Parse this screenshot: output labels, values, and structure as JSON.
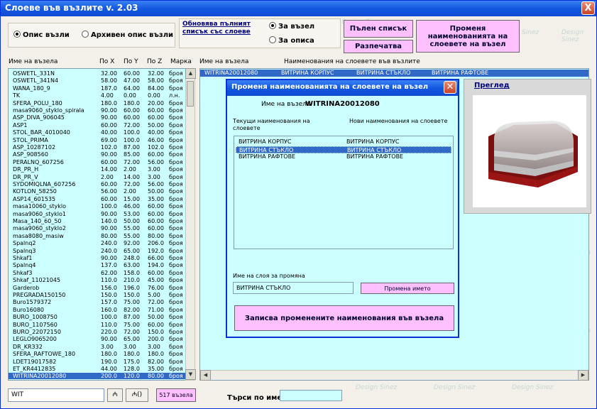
{
  "window": {
    "title": "Слоеве във възлите v. 2.03",
    "close": "X"
  },
  "radio_group1": [
    {
      "label": "Опис възли",
      "checked": true
    },
    {
      "label": "Архивен опис възли",
      "checked": false
    }
  ],
  "refresh_label": "Обновява пълният списък със слоеве",
  "radio_group2": [
    {
      "label": "За възел",
      "checked": true
    },
    {
      "label": "За описа",
      "checked": false
    }
  ],
  "buttons": {
    "full_list": "Пълен списък",
    "print": "Разпечатва",
    "rename_nodes": "Променя наименованията на слоевете на възел"
  },
  "list_headers": {
    "name": "Име на възела",
    "x": "По X",
    "y": "По Y",
    "z": "По Z",
    "brand": "Марка"
  },
  "right_headers": {
    "name": "Име на възела",
    "layers": "Наименования на слоевете във възлите"
  },
  "right_row": {
    "name": "WITRINA20012080",
    "c1": "ВИТРИНА КОРПУС",
    "c2": "ВИТРИНА СТЪКЛО",
    "c3": "ВИТРИНА РАФТОВЕ"
  },
  "rows": [
    [
      "OSWETL_331N",
      "32.00",
      "60.00",
      "32.00",
      "броя"
    ],
    [
      "OSWETL_341N4",
      "58.00",
      "47.00",
      "58.00",
      "броя"
    ],
    [
      "WANA_180_9",
      "187.0",
      "64.00",
      "84.00",
      "броя"
    ],
    [
      "TK",
      "4.00",
      "0.00",
      "0.00",
      "л.н."
    ],
    [
      "SFERA_POLU_180",
      "180.0",
      "180.0",
      "20.00",
      "броя"
    ],
    [
      "masa9060_styklo_spirala",
      "90.00",
      "60.00",
      "60.00",
      "броя"
    ],
    [
      "ASP_DIVA_906045",
      "90.00",
      "60.00",
      "60.00",
      "броя"
    ],
    [
      "ASP1",
      "60.00",
      "72.00",
      "50.00",
      "броя"
    ],
    [
      "STOL_BAR_4010040",
      "40.00",
      "100.0",
      "40.00",
      "броя"
    ],
    [
      "STOL_PRIMA",
      "69.00",
      "100.0",
      "46.00",
      "броя"
    ],
    [
      "ASP_10287102",
      "102.0",
      "87.00",
      "102.0",
      "броя"
    ],
    [
      "ASP_908560",
      "90.00",
      "85.00",
      "60.00",
      "броя"
    ],
    [
      "PERALNQ_607256",
      "60.00",
      "72.00",
      "56.00",
      "броя"
    ],
    [
      "DR_PR_H",
      "14.00",
      "2.00",
      "3.00",
      "броя"
    ],
    [
      "DR_PR_V",
      "2.00",
      "14.00",
      "3.00",
      "броя"
    ],
    [
      "SYDOMIQLNA_607256",
      "60.00",
      "72.00",
      "56.00",
      "броя"
    ],
    [
      "KOTLON_58250",
      "56.00",
      "2.00",
      "50.00",
      "броя"
    ],
    [
      "ASP14_601535",
      "60.00",
      "15.00",
      "35.00",
      "броя"
    ],
    [
      "masa10060_styklo",
      "100.0",
      "46.00",
      "60.00",
      "броя"
    ],
    [
      "masa9060_styklo1",
      "90.00",
      "53.00",
      "60.00",
      "броя"
    ],
    [
      "Masa_140_60_50",
      "140.0",
      "50.00",
      "60.00",
      "броя"
    ],
    [
      "masa9060_styklo2",
      "90.00",
      "55.00",
      "60.00",
      "броя"
    ],
    [
      "masa8080_masiw",
      "80.00",
      "55.00",
      "80.00",
      "броя"
    ],
    [
      "Spalnq2",
      "240.0",
      "92.00",
      "206.0",
      "броя"
    ],
    [
      "Spalnq3",
      "240.0",
      "65.00",
      "192.0",
      "броя"
    ],
    [
      "Shkaf1",
      "90.00",
      "248.0",
      "66.00",
      "броя"
    ],
    [
      "Spalnq4",
      "137.0",
      "63.00",
      "194.0",
      "броя"
    ],
    [
      "Shkaf3",
      "62.00",
      "158.0",
      "60.00",
      "броя"
    ],
    [
      "Shkaf_11021045",
      "110.0",
      "210.0",
      "45.00",
      "броя"
    ],
    [
      "Garderob",
      "156.0",
      "196.0",
      "76.00",
      "броя"
    ],
    [
      "PREGRADA150150",
      "150.0",
      "150.0",
      "5.00",
      "броя"
    ],
    [
      "Buro1579372",
      "157.0",
      "75.00",
      "72.00",
      "броя"
    ],
    [
      "Buro16080",
      "160.0",
      "82.00",
      "71.00",
      "броя"
    ],
    [
      "BURO_1008750",
      "100.0",
      "87.00",
      "50.00",
      "броя"
    ],
    [
      "BURO_1107560",
      "110.0",
      "75.00",
      "60.00",
      "броя"
    ],
    [
      "BURO_22072150",
      "220.0",
      "72.00",
      "150.0",
      "броя"
    ],
    [
      "LEGLO9065200",
      "90.00",
      "65.00",
      "200.0",
      "броя"
    ],
    [
      "DR_KR332",
      "3.00",
      "3.00",
      "3.00",
      "броя"
    ],
    [
      "SFERA_RAFTOWE_180",
      "180.0",
      "180.0",
      "180.0",
      "броя"
    ],
    [
      "LDET19017582",
      "190.0",
      "175.0",
      "82.00",
      "броя"
    ],
    [
      "ET_KR4412835",
      "44.00",
      "128.0",
      "35.00",
      "броя"
    ],
    [
      "WITRINA20012080",
      "200.0",
      "120.0",
      "80.00",
      "броя"
    ]
  ],
  "selected_row": 41,
  "search": {
    "value": "WIT",
    "find_glyph": "₼",
    "find_next_glyph": "₼()",
    "count": "517 възела",
    "by_name_label": "Търси по име",
    "by_name_value": ""
  },
  "dialog": {
    "title": "Променя наименованията на слоевете на възел",
    "node_label": "Име на възела",
    "node_name": "WITRINA20012080",
    "col_current": "Текущи наименования на слоевете",
    "col_new": "Нови наименования на слоевете",
    "layers": [
      [
        "ВИТРИНА КОРПУС",
        "ВИТРИНА КОРПУС"
      ],
      [
        "ВИТРИНА СТЪКЛО",
        "ВИТРИНА СТЪКЛО"
      ],
      [
        "ВИТРИНА РАФТОВЕ",
        "ВИТРИНА РАФТОВЕ"
      ]
    ],
    "selected_layer": 1,
    "change_label": "Име на слоя за промяна",
    "change_value": "ВИТРИНА СТЪКЛО",
    "rename_button": "Промена името",
    "save_button": "Записва променените наименования във възела"
  },
  "preview": {
    "label": "Преглед"
  },
  "watermark": "Design Sinez",
  "colors": {
    "list_bg": "#ccffff",
    "button_pink": "#ffc0ff",
    "selection": "#3169c6",
    "title_blue": "#1458e0"
  }
}
